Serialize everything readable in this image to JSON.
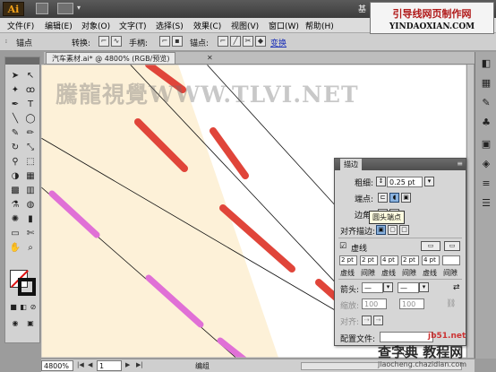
{
  "app": {
    "logo": "Ai",
    "title_right": "基",
    "title_close": "✕"
  },
  "watermark_top": {
    "line1": "引导线网页制作网",
    "line2": "YINDAOXIAN.COM"
  },
  "menu": [
    {
      "label": "文件(F)"
    },
    {
      "label": "编辑(E)"
    },
    {
      "label": "对象(O)"
    },
    {
      "label": "文字(T)"
    },
    {
      "label": "选择(S)"
    },
    {
      "label": "效果(C)"
    },
    {
      "label": "视图(V)"
    },
    {
      "label": "窗口(W)"
    },
    {
      "label": "帮助(H)"
    }
  ],
  "control_bar": {
    "anchor_label": "锚点",
    "convert_label": "转换:",
    "handles_label": "手柄:",
    "anchor2_label": "锚点:",
    "link_label": "变换"
  },
  "document": {
    "tab_label": "汽车素材.ai* @ 4800% (RGB/预览)",
    "close": "✕"
  },
  "canvas": {
    "watermark": "騰龍視覺WWW.TLVI.NET"
  },
  "status": {
    "zoom": "4800%",
    "page": "1",
    "label": "编组"
  },
  "stroke_panel": {
    "title": "描边",
    "weight_label": "粗细:",
    "weight_value": "0.25 pt",
    "cap_label": "端点:",
    "corner_label": "边角:",
    "tooltip": "圆头端点",
    "align_label": "对齐描边:",
    "dashed_label": "虚线",
    "dashed_checked": true,
    "dash_values": [
      "2 pt",
      "2 pt",
      "4 pt",
      "2 pt",
      "4 pt",
      ""
    ],
    "dash_labels": [
      "虚线",
      "间隙",
      "虚线",
      "间隙",
      "虚线",
      "间隙"
    ],
    "arrow_label": "箭头:",
    "scale_label": "缩放:",
    "scale_values": [
      "100",
      "100"
    ],
    "align_arrow_label": "对齐:",
    "profile_label": "配置文件:"
  },
  "watermark_bottom": {
    "line1": "jb51.net",
    "line2": "查字典 教程网",
    "line3": "jiaocheng.chazidian.com"
  },
  "colors": {
    "paper": "#fdf1d8",
    "red_dash": "#e0453a",
    "pink_dash": "#e070d6",
    "accent": "#8ab3e0"
  }
}
